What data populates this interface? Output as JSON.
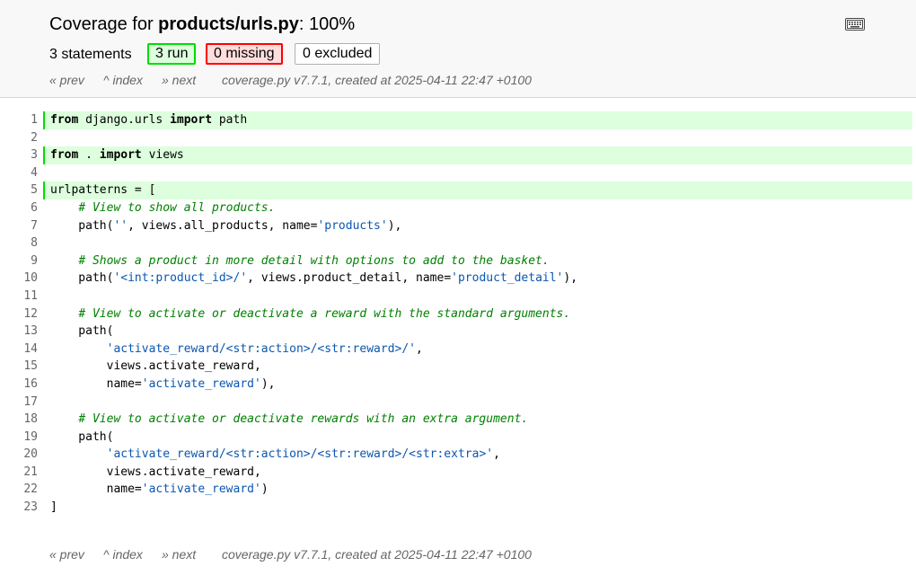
{
  "header": {
    "title_prefix": "Coverage for ",
    "title_file": "products/urls.py",
    "title_suffix": ": 100%",
    "keyboard_icon": "keyboard-icon",
    "statements_label": "3 statements",
    "run_label": "3 run",
    "missing_label": "0 missing",
    "excluded_label": "0 excluded"
  },
  "nav": {
    "prev": "« prev",
    "index": "^ index",
    "next": "» next",
    "meta": "coverage.py v7.7.1, created at 2025-04-11 22:47 +0100"
  },
  "colors": {
    "run_bg": "#ddffdd",
    "run_border": "#00dd00",
    "missing_bg": "#ffdddd",
    "missing_border": "#ff0000",
    "string": "#0b57b0",
    "comment": "#008000"
  },
  "source": {
    "lines": [
      {
        "n": "1",
        "run": true,
        "tokens": [
          {
            "t": "kw",
            "v": "from"
          },
          {
            "t": "p",
            "v": " django.urls "
          },
          {
            "t": "kw",
            "v": "import"
          },
          {
            "t": "p",
            "v": " path"
          }
        ]
      },
      {
        "n": "2",
        "run": false,
        "tokens": []
      },
      {
        "n": "3",
        "run": true,
        "tokens": [
          {
            "t": "kw",
            "v": "from"
          },
          {
            "t": "p",
            "v": " . "
          },
          {
            "t": "kw",
            "v": "import"
          },
          {
            "t": "p",
            "v": " views"
          }
        ]
      },
      {
        "n": "4",
        "run": false,
        "tokens": []
      },
      {
        "n": "5",
        "run": true,
        "tokens": [
          {
            "t": "p",
            "v": "urlpatterns = ["
          }
        ]
      },
      {
        "n": "6",
        "run": false,
        "tokens": [
          {
            "t": "p",
            "v": "    "
          },
          {
            "t": "com",
            "v": "# View to show all products."
          }
        ]
      },
      {
        "n": "7",
        "run": false,
        "tokens": [
          {
            "t": "p",
            "v": "    path("
          },
          {
            "t": "str",
            "v": "''"
          },
          {
            "t": "p",
            "v": ", views.all_products, name="
          },
          {
            "t": "str",
            "v": "'products'"
          },
          {
            "t": "p",
            "v": "),"
          }
        ]
      },
      {
        "n": "8",
        "run": false,
        "tokens": []
      },
      {
        "n": "9",
        "run": false,
        "tokens": [
          {
            "t": "p",
            "v": "    "
          },
          {
            "t": "com",
            "v": "# Shows a product in more detail with options to add to the basket."
          }
        ]
      },
      {
        "n": "10",
        "run": false,
        "tokens": [
          {
            "t": "p",
            "v": "    path("
          },
          {
            "t": "str",
            "v": "'<int:product_id>/'"
          },
          {
            "t": "p",
            "v": ", views.product_detail, name="
          },
          {
            "t": "str",
            "v": "'product_detail'"
          },
          {
            "t": "p",
            "v": "),"
          }
        ]
      },
      {
        "n": "11",
        "run": false,
        "tokens": []
      },
      {
        "n": "12",
        "run": false,
        "tokens": [
          {
            "t": "p",
            "v": "    "
          },
          {
            "t": "com",
            "v": "# View to activate or deactivate a reward with the standard arguments."
          }
        ]
      },
      {
        "n": "13",
        "run": false,
        "tokens": [
          {
            "t": "p",
            "v": "    path("
          }
        ]
      },
      {
        "n": "14",
        "run": false,
        "tokens": [
          {
            "t": "p",
            "v": "        "
          },
          {
            "t": "str",
            "v": "'activate_reward/<str:action>/<str:reward>/'"
          },
          {
            "t": "p",
            "v": ","
          }
        ]
      },
      {
        "n": "15",
        "run": false,
        "tokens": [
          {
            "t": "p",
            "v": "        views.activate_reward,"
          }
        ]
      },
      {
        "n": "16",
        "run": false,
        "tokens": [
          {
            "t": "p",
            "v": "        name="
          },
          {
            "t": "str",
            "v": "'activate_reward'"
          },
          {
            "t": "p",
            "v": "),"
          }
        ]
      },
      {
        "n": "17",
        "run": false,
        "tokens": []
      },
      {
        "n": "18",
        "run": false,
        "tokens": [
          {
            "t": "p",
            "v": "    "
          },
          {
            "t": "com",
            "v": "# View to activate or deactivate rewards with an extra argument."
          }
        ]
      },
      {
        "n": "19",
        "run": false,
        "tokens": [
          {
            "t": "p",
            "v": "    path("
          }
        ]
      },
      {
        "n": "20",
        "run": false,
        "tokens": [
          {
            "t": "p",
            "v": "        "
          },
          {
            "t": "str",
            "v": "'activate_reward/<str:action>/<str:reward>/<str:extra>'"
          },
          {
            "t": "p",
            "v": ","
          }
        ]
      },
      {
        "n": "21",
        "run": false,
        "tokens": [
          {
            "t": "p",
            "v": "        views.activate_reward,"
          }
        ]
      },
      {
        "n": "22",
        "run": false,
        "tokens": [
          {
            "t": "p",
            "v": "        name="
          },
          {
            "t": "str",
            "v": "'activate_reward'"
          },
          {
            "t": "p",
            "v": ")"
          }
        ]
      },
      {
        "n": "23",
        "run": false,
        "tokens": [
          {
            "t": "p",
            "v": "]"
          }
        ]
      }
    ]
  }
}
